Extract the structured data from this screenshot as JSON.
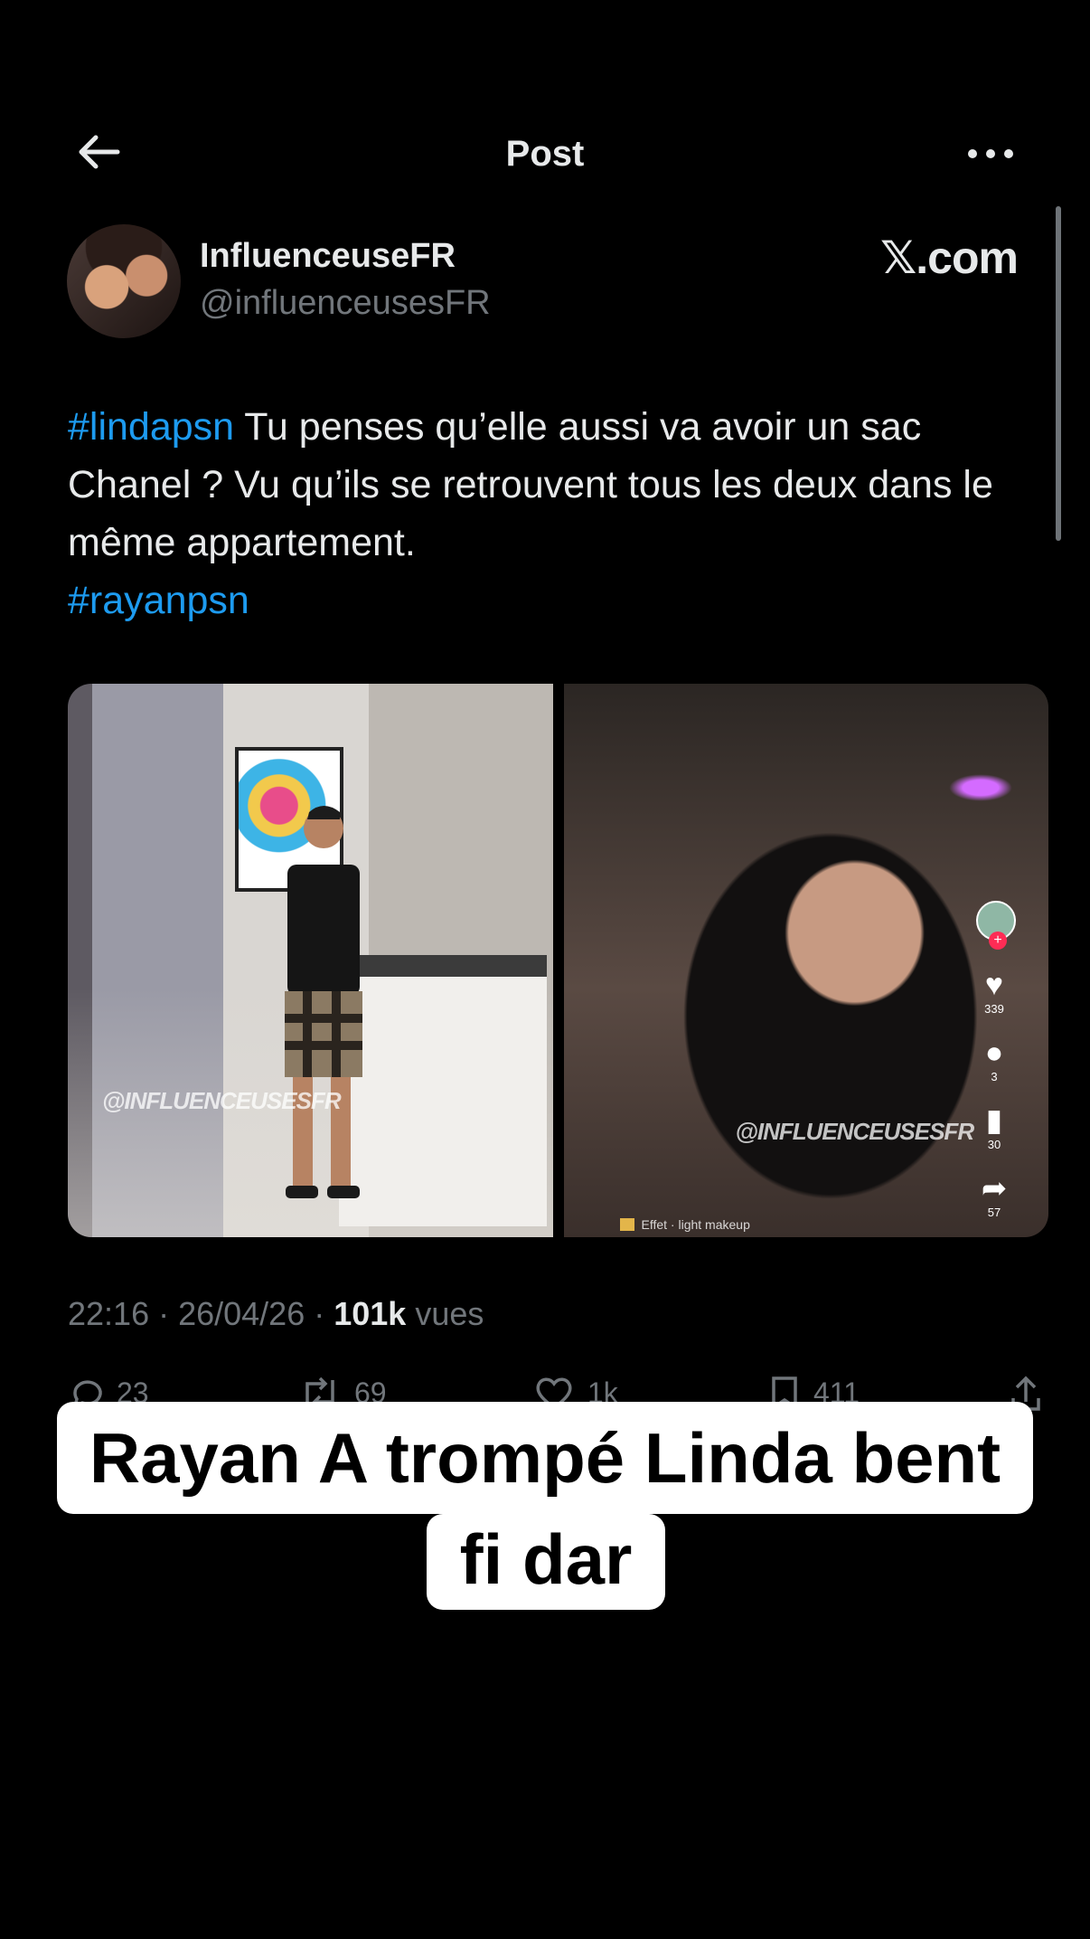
{
  "header": {
    "title": "Post",
    "back_icon": "arrow-left-icon",
    "more_icon": "more-horizontal-icon"
  },
  "author": {
    "display_name": "InfluenceuseFR",
    "handle": "@influenceusesFR",
    "brand": "𝕏.com"
  },
  "tweet": {
    "hashtag1": "#lindapsn",
    "text1": " Tu penses qu’elle aussi va avoir un sac Chanel ? Vu qu’ils se retrouvent tous les deux dans le même appartement.",
    "hashtag2": "#rayanpsn"
  },
  "media": {
    "watermark_left": "@INFLUENCEUSESFR",
    "watermark_right": "@INFLUENCEUSESFR",
    "tiktok_likes": "339",
    "tiktok_comments": "3",
    "tiktok_saves": "30",
    "tiktok_shares": "57",
    "effect_label": "Effet · light makeup"
  },
  "meta": {
    "time": "22:16 · 26/04/26 · ",
    "views_count": "101k",
    "views_label": " vues"
  },
  "actions": {
    "replies": "23",
    "reposts": "69",
    "likes": "1k",
    "bookmarks": "411"
  },
  "caption": {
    "line1": "Rayan A trompé Linda bent",
    "line2": "fi dar"
  },
  "colors": {
    "background": "#000000",
    "text": "#e7e9ea",
    "muted": "#71767b",
    "hashtag": "#1d9bf0"
  }
}
